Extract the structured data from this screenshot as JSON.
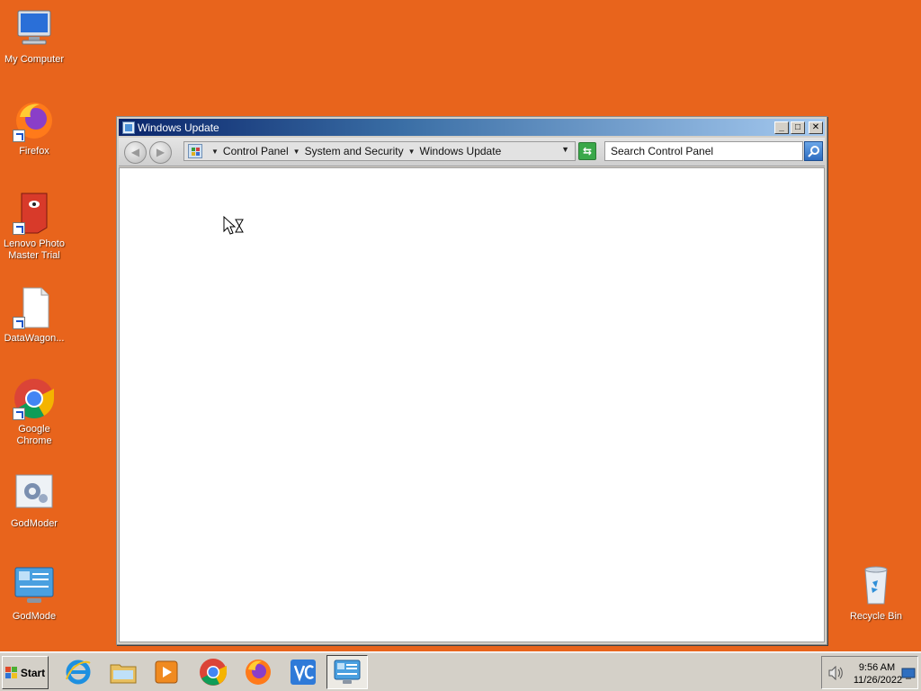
{
  "desktop": {
    "icons": [
      {
        "label": "My Computer"
      },
      {
        "label": "Firefox"
      },
      {
        "label": "Lenovo Photo Master Trial"
      },
      {
        "label": "DataWagon..."
      },
      {
        "label": "Google Chrome"
      },
      {
        "label": "GodModer"
      },
      {
        "label": "GodMode"
      },
      {
        "label": "Recycle Bin"
      }
    ],
    "background_color": "#e8641c"
  },
  "window": {
    "title": "Windows Update",
    "minimize_label": "_",
    "maximize_label": "□",
    "close_label": "✕",
    "back_label": "◀",
    "forward_label": "▶",
    "breadcrumbs": [
      "Control Panel",
      "System and Security",
      "Windows Update"
    ],
    "search_placeholder": "Search Control Panel",
    "search_icon": "search-icon"
  },
  "taskbar": {
    "start_label": "Start",
    "apps": [
      {
        "name": "internet-explorer-icon"
      },
      {
        "name": "file-explorer-icon"
      },
      {
        "name": "media-player-icon"
      },
      {
        "name": "chrome-icon"
      },
      {
        "name": "firefox-icon"
      },
      {
        "name": "vscode-icon"
      },
      {
        "name": "control-panel-icon"
      }
    ],
    "clock_time": "9:56 AM",
    "clock_date": "11/26/2022"
  }
}
